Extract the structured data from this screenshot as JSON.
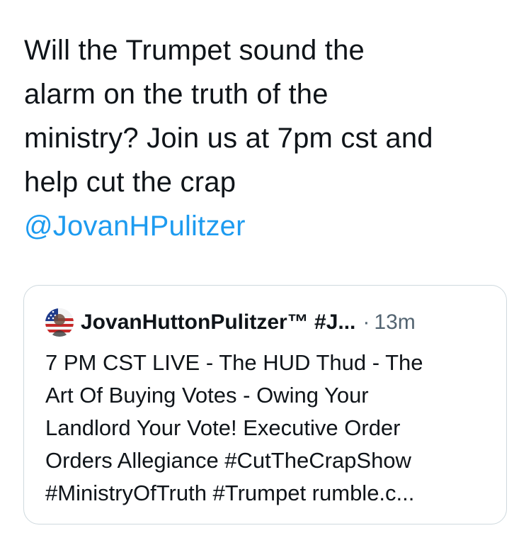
{
  "tweet": {
    "lines": [
      "Will the Trumpet sound the",
      "alarm on the truth of the",
      "ministry? Join us at 7pm cst and",
      "help cut the crap"
    ],
    "mention": "@JovanHPulitzer",
    "mention_color": "#1d9bf0"
  },
  "quoted_tweet": {
    "avatar_icon": "flag-avatar-icon",
    "display_name": "JovanHuttonPulitzer™ #J...",
    "separator": "·",
    "time": "13m",
    "lines": [
      "7 PM CST LIVE - The HUD Thud - The",
      "Art Of Buying Votes - Owing Your",
      "Landlord Your Vote! Executive Order",
      "Orders Allegiance #CutTheCrapShow",
      "#MinistryOfTruth #Trumpet rumble.c..."
    ]
  },
  "colors": {
    "text": "#0f1419",
    "secondary_text": "#536471",
    "border": "#cfd9de",
    "link": "#1d9bf0"
  }
}
